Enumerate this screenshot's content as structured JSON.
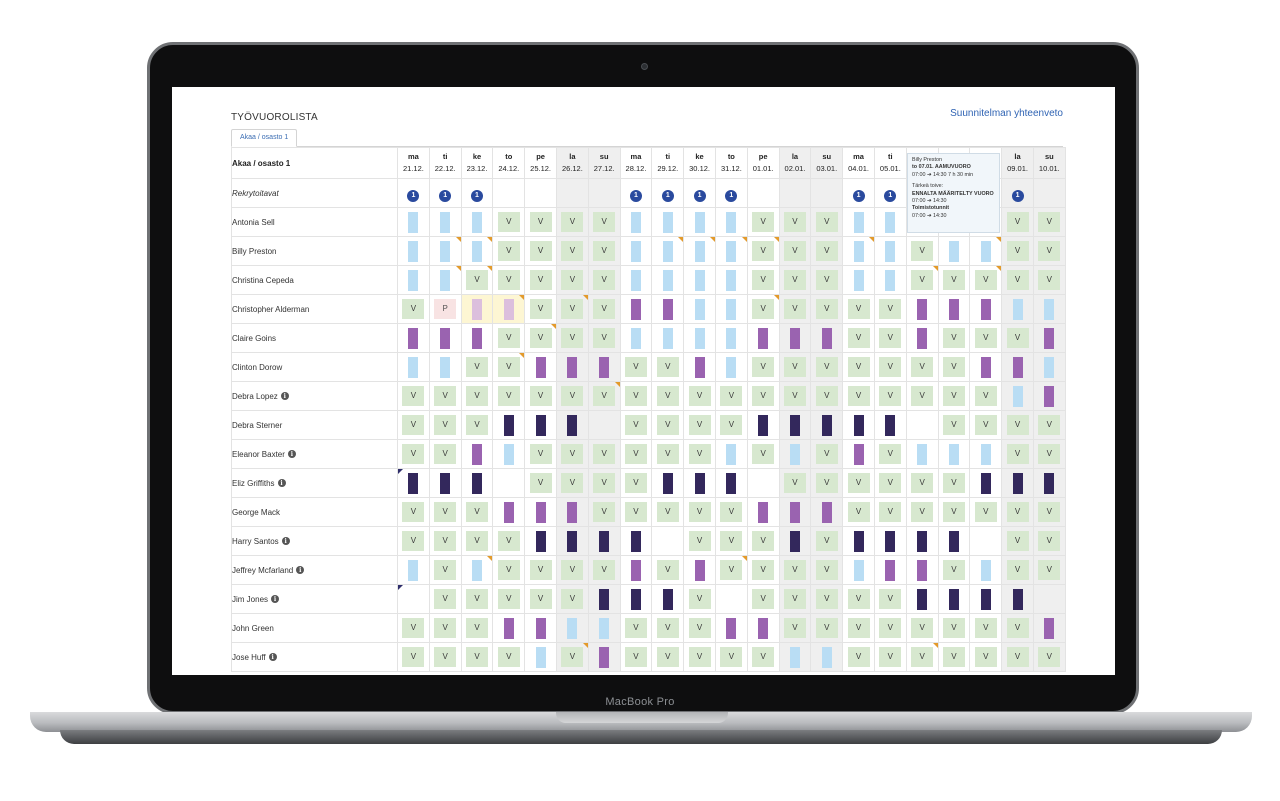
{
  "device_label": "MacBook Pro",
  "page_title": "TYÖVUOROLISTA",
  "summary_link": "Suunnitelman yhteenveto",
  "tab_label": "Akaa / osasto 1",
  "table_header": "Akaa / osasto 1",
  "days": [
    {
      "dow": "ma",
      "date": "21.12.",
      "weekend": false
    },
    {
      "dow": "ti",
      "date": "22.12.",
      "weekend": false
    },
    {
      "dow": "ke",
      "date": "23.12.",
      "weekend": false
    },
    {
      "dow": "to",
      "date": "24.12.",
      "weekend": false
    },
    {
      "dow": "pe",
      "date": "25.12.",
      "weekend": false
    },
    {
      "dow": "la",
      "date": "26.12.",
      "weekend": true
    },
    {
      "dow": "su",
      "date": "27.12.",
      "weekend": true
    },
    {
      "dow": "ma",
      "date": "28.12.",
      "weekend": false
    },
    {
      "dow": "ti",
      "date": "29.12.",
      "weekend": false
    },
    {
      "dow": "ke",
      "date": "30.12.",
      "weekend": false
    },
    {
      "dow": "to",
      "date": "31.12.",
      "weekend": false
    },
    {
      "dow": "pe",
      "date": "01.01.",
      "weekend": false
    },
    {
      "dow": "la",
      "date": "02.01.",
      "weekend": true
    },
    {
      "dow": "su",
      "date": "03.01.",
      "weekend": true
    },
    {
      "dow": "ma",
      "date": "04.01.",
      "weekend": false
    },
    {
      "dow": "ti",
      "date": "05.01.",
      "weekend": false
    },
    {
      "dow": "",
      "date": "",
      "weekend": false
    },
    {
      "dow": "",
      "date": "",
      "weekend": false
    },
    {
      "dow": "",
      "date": "",
      "weekend": false
    },
    {
      "dow": "la",
      "date": "09.01.",
      "weekend": true
    },
    {
      "dow": "su",
      "date": "10.01.",
      "weekend": true
    }
  ],
  "recruit_row": {
    "label": "Rekrytoitavat",
    "values": [
      "1",
      "1",
      "1",
      "",
      "",
      "",
      "",
      "1",
      "1",
      "1",
      "1",
      "",
      "",
      "",
      "1",
      "1",
      "",
      "",
      "",
      "1",
      ""
    ]
  },
  "employees": [
    {
      "name": "Antonia Sell",
      "info": false,
      "cells": [
        "L",
        "L",
        "L",
        "V",
        "V",
        "V",
        "V",
        "L",
        "L",
        "L",
        "L",
        "V",
        "V",
        "V",
        "L",
        "L",
        "",
        "",
        "",
        "V",
        "V"
      ]
    },
    {
      "name": "Billy Preston",
      "info": false,
      "cells": [
        "L",
        "L^",
        "L^",
        "V",
        "V",
        "V",
        "V",
        "L",
        "L^",
        "L^",
        "L^",
        "V^",
        "V",
        "V",
        "L^",
        "L",
        "V",
        "L",
        "L^",
        "V",
        "V"
      ]
    },
    {
      "name": "Christina Cepeda",
      "info": false,
      "cells": [
        "L",
        "L^",
        "V^",
        "V",
        "V",
        "V",
        "V",
        "L",
        "L",
        "L",
        "L",
        "V",
        "V",
        "V",
        "L",
        "L",
        "V^",
        "V",
        "V^",
        "V",
        "V"
      ]
    },
    {
      "name": "Christopher Alderman",
      "info": false,
      "cells": [
        "V",
        "P",
        "Q*",
        "Q*^",
        "V",
        "V^",
        "V",
        "P",
        "P",
        "L",
        "L",
        "V^",
        "V",
        "V",
        "V",
        "V",
        "P",
        "P",
        "P",
        "L",
        "L"
      ]
    },
    {
      "name": "Claire Goins",
      "info": false,
      "cells": [
        "P",
        "P",
        "P",
        "V",
        "V^",
        "V",
        "V",
        "L",
        "L",
        "L",
        "L",
        "P",
        "P",
        "P",
        "V",
        "V",
        "P",
        "V",
        "V",
        "V",
        "P"
      ]
    },
    {
      "name": "Clinton Dorow",
      "info": false,
      "cells": [
        "L",
        "L",
        "V",
        "V^",
        "P",
        "P",
        "P",
        "V",
        "V",
        "P",
        "L",
        "V",
        "V",
        "V",
        "V",
        "V",
        "V",
        "V",
        "P",
        "P",
        "L"
      ]
    },
    {
      "name": "Debra Lopez",
      "info": true,
      "cells": [
        "V",
        "V",
        "V",
        "V",
        "V",
        "V",
        "V^",
        "V",
        "V",
        "V",
        "V",
        "V",
        "V",
        "V",
        "V",
        "V",
        "V",
        "V",
        "V",
        "L",
        "P"
      ]
    },
    {
      "name": "Debra Sterner",
      "info": false,
      "cells": [
        "V",
        "V",
        "V",
        "D",
        "D",
        "D",
        "",
        "V",
        "V",
        "V",
        "V",
        "D",
        "D",
        "D",
        "D",
        "D",
        "",
        "V",
        "V",
        "V",
        "V"
      ]
    },
    {
      "name": "Eleanor Baxter",
      "info": true,
      "cells": [
        "V",
        "V",
        "P",
        "L",
        "V",
        "V",
        "V",
        "V",
        "V",
        "V",
        "L",
        "V",
        "L",
        "V",
        "P",
        "V",
        "L",
        "L",
        "L",
        "V",
        "V"
      ]
    },
    {
      "name": "Eliz Griffiths",
      "info": true,
      "cells": [
        "D#",
        "D",
        "D",
        "",
        "V",
        "V",
        "V",
        "V",
        "D",
        "D",
        "D",
        "",
        "V",
        "V",
        "V",
        "V",
        "V",
        "V",
        "D",
        "D",
        "D"
      ]
    },
    {
      "name": "George Mack",
      "info": false,
      "cells": [
        "V",
        "V",
        "V",
        "P",
        "P",
        "P",
        "V",
        "V",
        "V",
        "V",
        "V",
        "P",
        "P",
        "P",
        "V",
        "V",
        "V",
        "V",
        "V",
        "V",
        "V"
      ]
    },
    {
      "name": "Harry Santos",
      "info": true,
      "cells": [
        "V",
        "V",
        "V",
        "V",
        "D",
        "D",
        "D",
        "D",
        "",
        "V",
        "V",
        "V",
        "D",
        "V",
        "D",
        "D",
        "D",
        "D",
        "",
        "V",
        "V"
      ]
    },
    {
      "name": "Jeffrey Mcfarland",
      "info": true,
      "cells": [
        "L",
        "V",
        "L^",
        "V",
        "V",
        "V",
        "V",
        "P",
        "V",
        "P",
        "V^",
        "V",
        "V",
        "V",
        "L",
        "P",
        "P",
        "V",
        "L",
        "V",
        "V"
      ]
    },
    {
      "name": "Jim Jones",
      "info": true,
      "cells": [
        "#",
        "V",
        "V",
        "V",
        "V",
        "V",
        "D",
        "D",
        "D",
        "V",
        "",
        "V",
        "V",
        "V",
        "V",
        "V",
        "D",
        "D",
        "D",
        "D",
        ""
      ]
    },
    {
      "name": "John Green",
      "info": false,
      "cells": [
        "V",
        "V",
        "V",
        "P",
        "P",
        "L",
        "L",
        "V",
        "V",
        "V",
        "P",
        "P",
        "V",
        "V",
        "V",
        "V",
        "V",
        "V",
        "V",
        "V",
        "P"
      ]
    },
    {
      "name": "Jose Huff",
      "info": true,
      "cells": [
        "V",
        "V",
        "V",
        "V",
        "L",
        "V^",
        "P",
        "V",
        "V",
        "V",
        "V",
        "V",
        "L",
        "L",
        "V",
        "V",
        "V^",
        "V",
        "V",
        "V",
        "V"
      ]
    }
  ],
  "tooltip": {
    "name": "Billy Preston",
    "line1": "to 07.01. AAMUVUORO",
    "line2": "07:00 ➔ 14:30   7 h 30 min",
    "label_important": "Tärkeä toive:",
    "important": "ENNALTA MÄÄRITELTY VUORO",
    "important_time": "07:00 ➔ 14:30",
    "label_office": "Toimistotunnit",
    "office_time": "07:00 ➔ 14:30"
  },
  "colors": {
    "light_shift": "#b9ddf4",
    "purple_shift": "#9a63b0",
    "dark_shift": "#33285c",
    "vacation": "#d7e8cf",
    "flag": "#e39a2b",
    "accent": "#2f63b3"
  }
}
